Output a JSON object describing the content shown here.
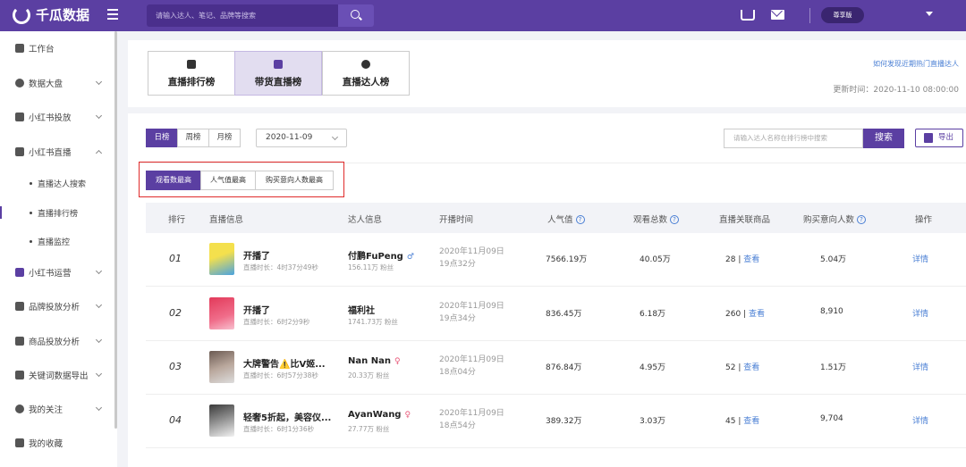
{
  "app": {
    "brand": "千瓜数据",
    "search_placeholder": "请输入达人、笔记、品牌等搜索",
    "vip_label": "尊享版"
  },
  "sidebar": {
    "items": [
      {
        "label": "工作台",
        "icon": "grid-icon"
      },
      {
        "label": "数据大盘",
        "icon": "pie-chart-icon"
      },
      {
        "label": "小红书投放",
        "icon": "shield-icon"
      },
      {
        "label": "小红书直播",
        "icon": "video-icon"
      },
      {
        "label": "小红书运营",
        "icon": "heart-icon"
      },
      {
        "label": "品牌投放分析",
        "icon": "bar-chart-icon"
      },
      {
        "label": "商品投放分析",
        "icon": "goods-icon"
      },
      {
        "label": "关键词数据导出",
        "icon": "export-icon"
      },
      {
        "label": "我的关注",
        "icon": "eye-icon"
      },
      {
        "label": "我的收藏",
        "icon": "folder-icon"
      }
    ],
    "sub_items": [
      {
        "label": "直播达人搜索"
      },
      {
        "label": "直播排行榜"
      },
      {
        "label": "直播监控"
      }
    ]
  },
  "ranking_tabs": [
    {
      "label": "直播排行榜",
      "icon": "microphone-icon"
    },
    {
      "label": "带货直播榜",
      "icon": "cart-icon"
    },
    {
      "label": "直播达人榜",
      "icon": "person-icon"
    }
  ],
  "help_link": "如何发现近期热门直播达人",
  "update_time": "更新时间：2020-11-10 08:00:00",
  "period_tabs": [
    "日榜",
    "周榜",
    "月榜"
  ],
  "date_value": "2020-11-09",
  "search": {
    "placeholder": "请输入达人名称在排行榜中搜索",
    "button": "搜索"
  },
  "export_label": "导出",
  "sort_tabs": [
    "观看数最高",
    "人气值最高",
    "购买意向人数最高"
  ],
  "table": {
    "headers": [
      "排行",
      "直播信息",
      "达人信息",
      "开播时间",
      "人气值",
      "观看总数",
      "直播关联商品",
      "购买意向人数",
      "操作"
    ],
    "rows": [
      {
        "rank": "01",
        "title": "开播了",
        "duration": "直播时长：4时37分49秒",
        "talent": "付鹏FuPeng",
        "gender": "♂",
        "fans": "156.11万 粉丝",
        "date": "2020年11月09日",
        "time": "19点32分",
        "popularity": "7566.19万",
        "views": "40.05万",
        "goods": "28",
        "view_link": "查看",
        "buyers": "5.04万",
        "action": "详情"
      },
      {
        "rank": "02",
        "title": "开播了",
        "duration": "直播时长：6时2分9秒",
        "talent": "福利社",
        "gender": "",
        "fans": "1741.73万 粉丝",
        "date": "2020年11月09日",
        "time": "19点34分",
        "popularity": "836.45万",
        "views": "6.18万",
        "goods": "260",
        "view_link": "查看",
        "buyers": "8,910",
        "action": "详情"
      },
      {
        "rank": "03",
        "title": "大牌警告⚠️比V姬...",
        "duration": "直播时长：6时57分38秒",
        "talent": "Nan Nan",
        "gender": "♀",
        "fans": "20.33万 粉丝",
        "date": "2020年11月09日",
        "time": "18点04分",
        "popularity": "876.84万",
        "views": "4.95万",
        "goods": "52",
        "view_link": "查看",
        "buyers": "1.51万",
        "action": "详情"
      },
      {
        "rank": "04",
        "title": "轻奢5折起，美容仪...",
        "duration": "直播时长：6时1分36秒",
        "talent": "AyanWang",
        "gender": "♀",
        "fans": "27.77万 粉丝",
        "date": "2020年11月09日",
        "time": "18点54分",
        "popularity": "389.32万",
        "views": "3.03万",
        "goods": "45",
        "view_link": "查看",
        "buyers": "9,704",
        "action": "详情"
      }
    ]
  },
  "colors": {
    "brand": "#5b3fa2",
    "link": "#4a7fd4",
    "highlight": "#e02b2b"
  }
}
